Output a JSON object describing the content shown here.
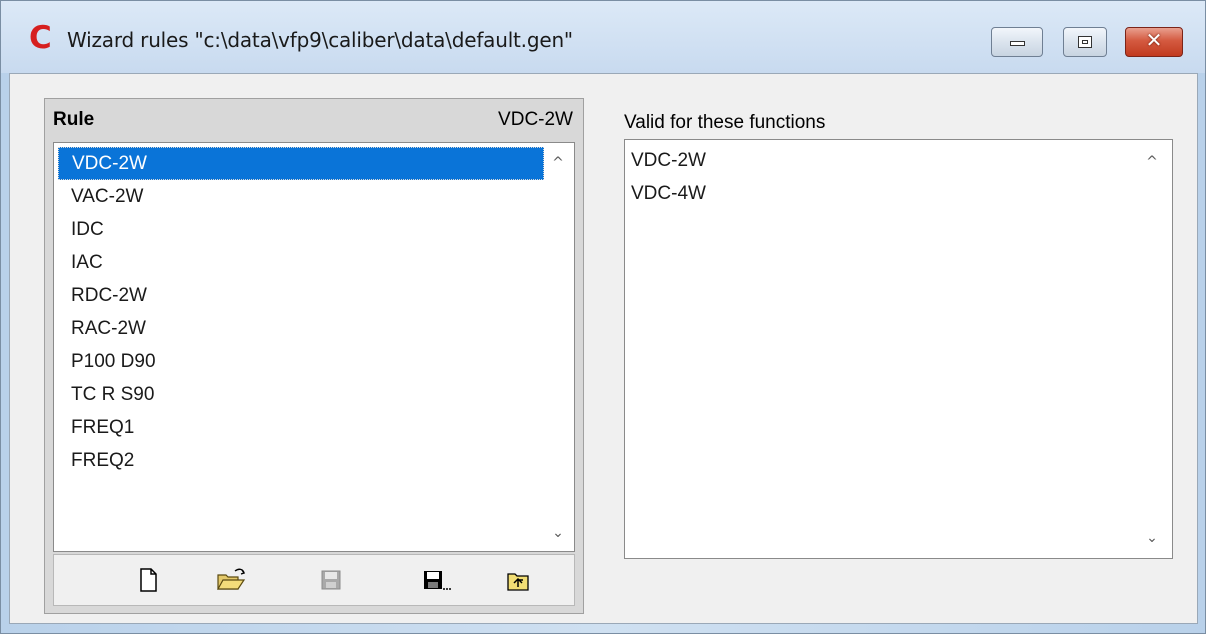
{
  "window": {
    "title": "Wizard rules \"c:\\data\\vfp9\\caliber\\data\\default.gen\"",
    "icon_glyph": "C",
    "accent": "#d61f1f"
  },
  "controls": {
    "minimize_icon": "minimize-icon",
    "maximize_icon": "maximize-icon",
    "close_glyph": "✕"
  },
  "rules": {
    "header_label": "Rule",
    "header_value": "VDC-2W",
    "selected_index": 0,
    "selection_color": "#0a74d8",
    "items": [
      "VDC-2W",
      "VAC-2W",
      "IDC",
      "IAC",
      "RDC-2W",
      "RAC-2W",
      "P100 D90",
      "TC R S90",
      "FREQ1",
      "FREQ2"
    ],
    "scroll_up": "^",
    "scroll_down": "⌄"
  },
  "toolbar": {
    "buttons": [
      {
        "name": "new-icon",
        "enabled": true
      },
      {
        "name": "open-folder-icon",
        "enabled": true
      },
      {
        "name": "save-icon",
        "enabled": false
      },
      {
        "name": "save-as-icon",
        "enabled": true
      },
      {
        "name": "export-icon",
        "enabled": true
      }
    ]
  },
  "functions": {
    "label": "Valid for these functions",
    "items": [
      "VDC-2W",
      "VDC-4W"
    ],
    "scroll_up": "^",
    "scroll_down": "⌄"
  }
}
